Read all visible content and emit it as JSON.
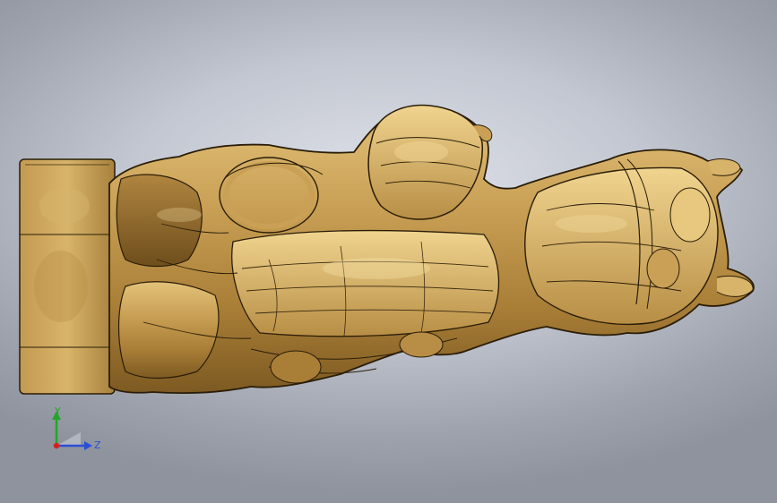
{
  "viewport": {
    "background_top": "#dfe2ea",
    "background_bottom": "#8e939e"
  },
  "model": {
    "material_color": "#c9a55a",
    "edge_color": "#2a1d08"
  },
  "triad": {
    "y_label": "Y",
    "z_label": "Z",
    "y_color": "#22a52a",
    "z_color": "#2b4fd6",
    "x_color": "#d42020"
  }
}
